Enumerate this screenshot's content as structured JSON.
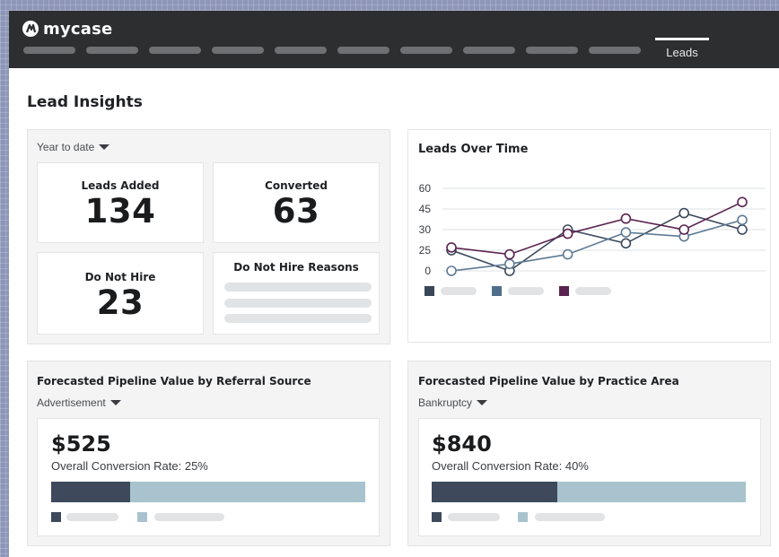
{
  "app": {
    "logo": "mycase"
  },
  "nav": {
    "active_tab": "Leads"
  },
  "page": {
    "title": "Lead Insights"
  },
  "summary": {
    "period": "Year to date",
    "leads_added": {
      "label": "Leads Added",
      "value": "134"
    },
    "converted": {
      "label": "Converted",
      "value": "63"
    },
    "do_not_hire": {
      "label": "Do Not Hire",
      "value": "23"
    },
    "reasons": {
      "label": "Do Not Hire Reasons"
    }
  },
  "leads_chart": {
    "title": "Leads Over Time"
  },
  "chart_data": {
    "type": "line",
    "title": "Leads Over Time",
    "y_ticks": [
      "60",
      "45",
      "30",
      "25",
      "0"
    ],
    "x": [
      1,
      2,
      3,
      4,
      5,
      6
    ],
    "series": [
      {
        "color": "#3d4a5c",
        "values": [
          15,
          0,
          30,
          20,
          42,
          30
        ]
      },
      {
        "color": "#5e7a96",
        "values": [
          0,
          5,
          12,
          28,
          25,
          37
        ]
      },
      {
        "color": "#5b2350",
        "values": [
          17,
          12,
          27,
          38,
          30,
          50
        ]
      }
    ],
    "legend_colors": [
      "#394657",
      "#4f6e8c",
      "#5b2350"
    ]
  },
  "referral": {
    "title": "Forecasted Pipeline Value by Referral Source",
    "filter": "Advertisement",
    "value": "$525",
    "rate_text": "Overall Conversion Rate: 25%",
    "conversion_fraction": 0.25
  },
  "practice": {
    "title": "Forecasted Pipeline Value by Practice Area",
    "filter": "Bankruptcy",
    "value": "$840",
    "rate_text": "Overall Conversion Rate: 40%",
    "conversion_fraction": 0.4
  },
  "colors": {
    "bar_dark": "#3e4a5b",
    "bar_light": "#a8c3ce"
  }
}
